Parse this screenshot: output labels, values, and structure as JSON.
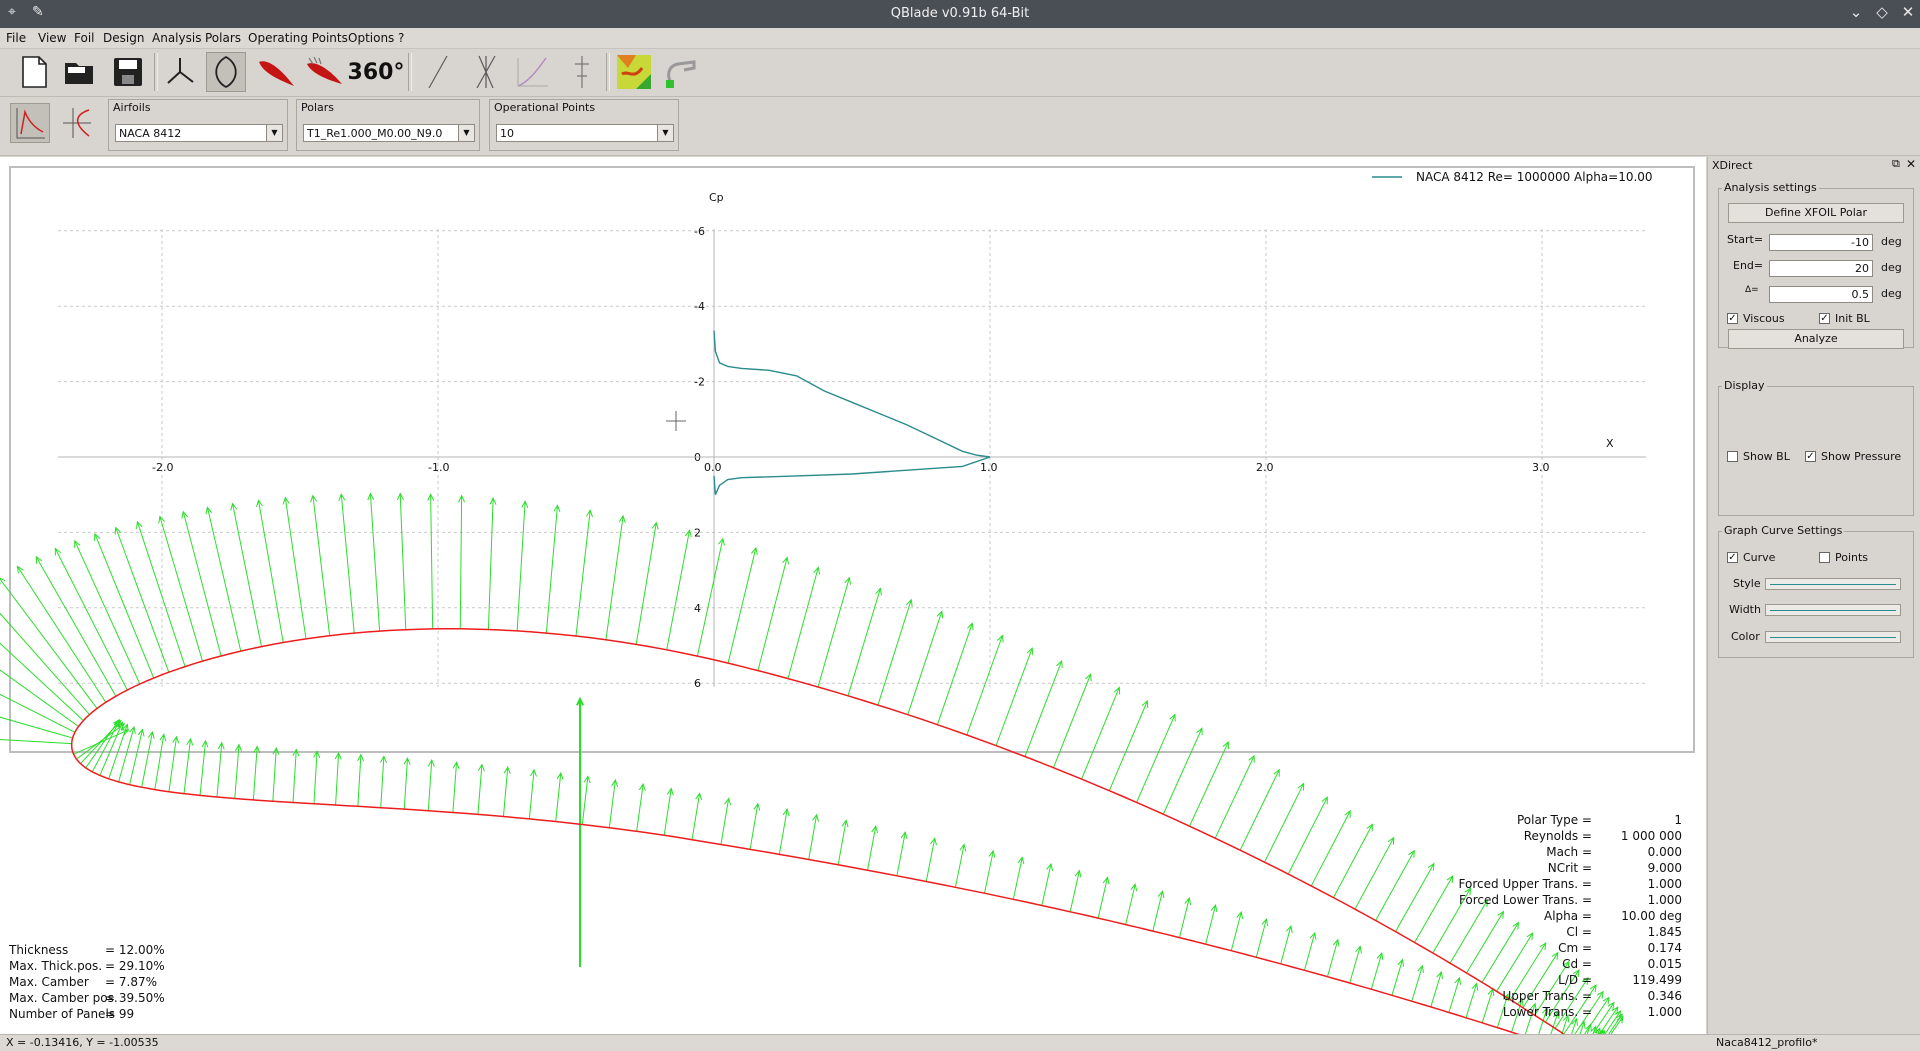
{
  "window": {
    "title": "QBlade v0.91b 64-Bit"
  },
  "menu": [
    "File",
    "View",
    "Foil",
    "Design",
    "Analysis",
    "Polars",
    "Operating Points",
    "Options",
    "?"
  ],
  "toolbar": {
    "icon_360": "360°"
  },
  "selectors": {
    "airfoils_label": "Airfoils",
    "airfoil_value": "NACA 8412",
    "polars_label": "Polars",
    "polar_value": "T1_Re1.000_M0.00_N9.0",
    "oppoints_label": "Operational Points",
    "oppoint_value": "10"
  },
  "legend": {
    "entry": "NACA 8412 Re= 1000000 Alpha=10.00",
    "color": "#2a8c8c"
  },
  "chart_data": {
    "type": "line",
    "ylabel": "Cp",
    "xlabel": "X",
    "x_ticks": [
      "-2.0",
      "-1.0",
      "0.0",
      "1.0",
      "2.0",
      "3.0"
    ],
    "y_ticks": [
      "-6",
      "-4",
      "-2",
      "0",
      "2",
      "4",
      "6"
    ],
    "xlim": [
      -2.4,
      3.4
    ],
    "ylim": [
      -6,
      6
    ],
    "inverted_y": true,
    "grid": true,
    "series": [
      {
        "name": "NACA 8412 Re= 1000000 Alpha=10.00",
        "x": [
          0.0,
          0.005,
          0.02,
          0.05,
          0.1,
          0.2,
          0.3,
          0.35,
          0.4,
          0.5,
          0.6,
          0.7,
          0.8,
          0.9,
          0.95,
          1.0
        ],
        "y": [
          -3.35,
          -2.8,
          -2.5,
          -2.4,
          -2.35,
          -2.3,
          -2.15,
          -1.95,
          -1.75,
          -1.45,
          -1.15,
          -0.85,
          -0.5,
          -0.15,
          -0.05,
          0.0
        ]
      },
      {
        "name": "",
        "x": [
          0.0,
          0.005,
          0.02,
          0.05,
          0.1,
          0.3,
          0.5,
          0.7,
          0.9,
          1.0
        ],
        "y": [
          0.5,
          1.0,
          0.75,
          0.6,
          0.55,
          0.5,
          0.45,
          0.35,
          0.25,
          0.0
        ]
      }
    ]
  },
  "airfoil": {
    "name": "NACA 8412",
    "color": "#ee1d1d",
    "vector_color": "#2bdd2b",
    "vectors": "pressure"
  },
  "geometry_info": [
    {
      "label": "Thickness",
      "value": "= 12.00%"
    },
    {
      "label": "Max. Thick.pos.",
      "value": "= 29.10%"
    },
    {
      "label": "Max. Camber",
      "value": "= 7.87%"
    },
    {
      "label": "Max. Camber pos.",
      "value": "= 39.50%"
    },
    {
      "label": "Number of Panels",
      "value": "= 99"
    }
  ],
  "results": [
    {
      "label": "Polar Type =",
      "value": "1"
    },
    {
      "label": "Reynolds =",
      "value": "1 000 000"
    },
    {
      "label": "Mach =",
      "value": "0.000"
    },
    {
      "label": "NCrit =",
      "value": "9.000"
    },
    {
      "label": "Forced Upper Trans. =",
      "value": "1.000"
    },
    {
      "label": "Forced Lower Trans. =",
      "value": "1.000"
    },
    {
      "label": "Alpha =",
      "value": "10.00 deg"
    },
    {
      "label": "Cl =",
      "value": "1.845"
    },
    {
      "label": "Cm =",
      "value": "0.174"
    },
    {
      "label": "Cd =",
      "value": "0.015"
    },
    {
      "label": "L/D =",
      "value": "119.499"
    },
    {
      "label": "Upper Trans. =",
      "value": "0.346"
    },
    {
      "label": "Lower Trans. =",
      "value": "1.000"
    }
  ],
  "status": {
    "coords": "X = -0.13416, Y = -1.00535",
    "file": "Naca8412_profilo*"
  },
  "xdirect": {
    "title": "XDirect",
    "analysis_settings": "Analysis settings",
    "define_button": "Define XFOIL Polar",
    "start_label": "Start=",
    "start_value": "-10",
    "end_label": "End=",
    "end_value": "20",
    "delta_label": "Δ=",
    "delta_value": "0.5",
    "unit": "deg",
    "viscous": "Viscous",
    "init_bl": "Init BL",
    "analyze_button": "Analyze",
    "display": "Display",
    "show_bl": "Show BL",
    "show_pressure": "Show Pressure",
    "graph_curve_settings": "Graph Curve Settings",
    "curve": "Curve",
    "points": "Points",
    "style": "Style",
    "width": "Width",
    "color": "Color"
  }
}
